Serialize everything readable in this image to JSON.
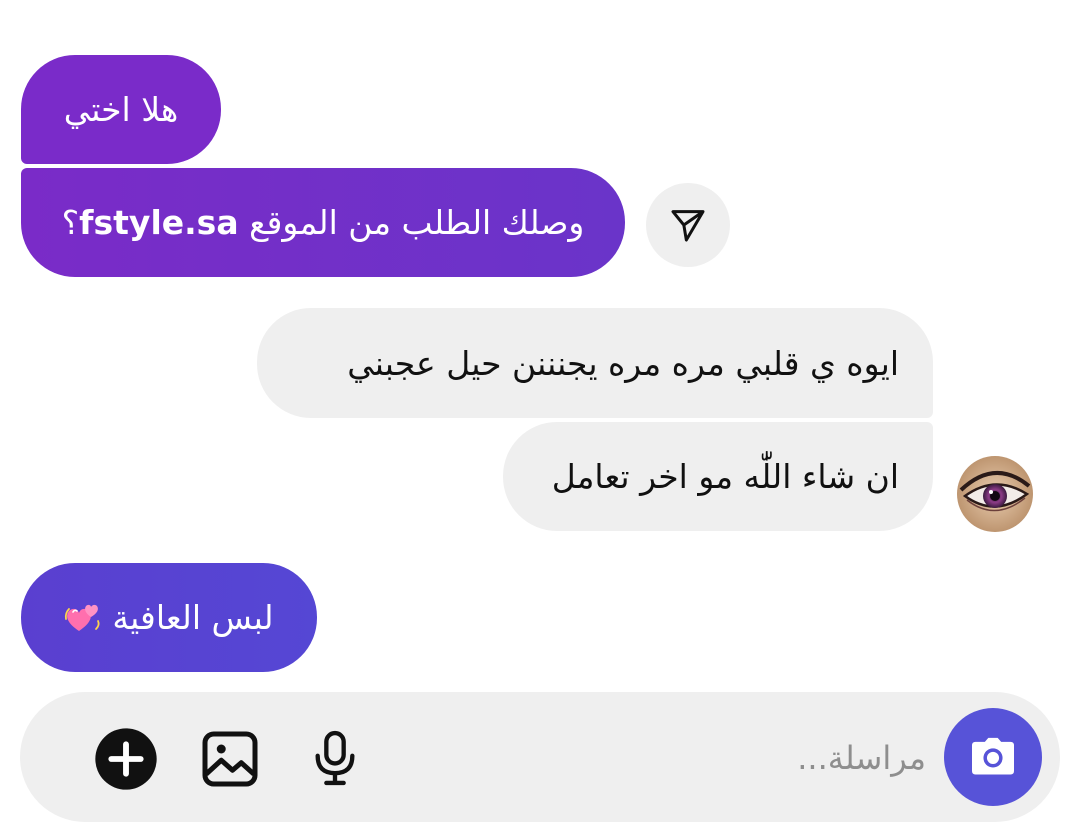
{
  "messages": [
    {
      "direction": "sent",
      "text": "هلا اختي"
    },
    {
      "direction": "sent",
      "text_before": "وصلك الطلب من الموقع ",
      "domain": "fstyle.sa",
      "text_after": "؟"
    },
    {
      "direction": "received",
      "text": "ايوه ي قلبي مره مره يجنننن حيل عجبني"
    },
    {
      "direction": "received",
      "text": "ان شاء اللّٰه مو اخر تعامل"
    },
    {
      "direction": "sent",
      "text": "لبس العافية",
      "emoji": "two-hearts"
    }
  ],
  "composer": {
    "placeholder": "مراسلة..."
  },
  "icons": {
    "share": "paper-plane-icon",
    "camera": "camera-icon",
    "mic": "microphone-icon",
    "gallery": "image-icon",
    "add": "plus-circle-icon"
  },
  "colors": {
    "sent_bubble_1": "#7a2bc9",
    "sent_bubble_2": "#6a34c9",
    "sent_bubble_3": "#5547d4",
    "received_bubble": "#efefef",
    "camera_button": "#5753d8",
    "composer_background": "#efefef"
  }
}
